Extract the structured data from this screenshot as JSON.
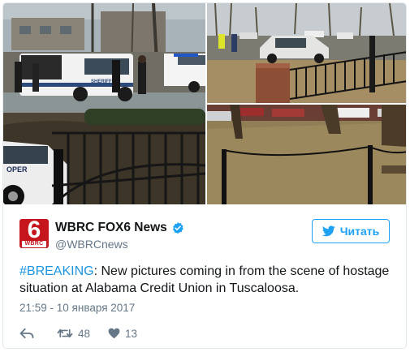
{
  "account": {
    "display_name": "WBRC FOX6 News",
    "handle": "@WBRCnews",
    "avatar_number": "6",
    "avatar_text": "WBRC"
  },
  "follow_button": {
    "label": "Читать"
  },
  "tweet": {
    "hashtag": "#BREAKING",
    "text": ": New pictures coming in from the scene of hostage situation at Alabama Credit Union in Tuscaloosa.",
    "timestamp": "21:59 - 10 января 2017"
  },
  "actions": {
    "retweets": "48",
    "likes": "13"
  },
  "colors": {
    "accent": "#1da1f2",
    "brand": "#c4161c",
    "muted": "#657786"
  },
  "media": {
    "car_door_text": "OPER"
  }
}
